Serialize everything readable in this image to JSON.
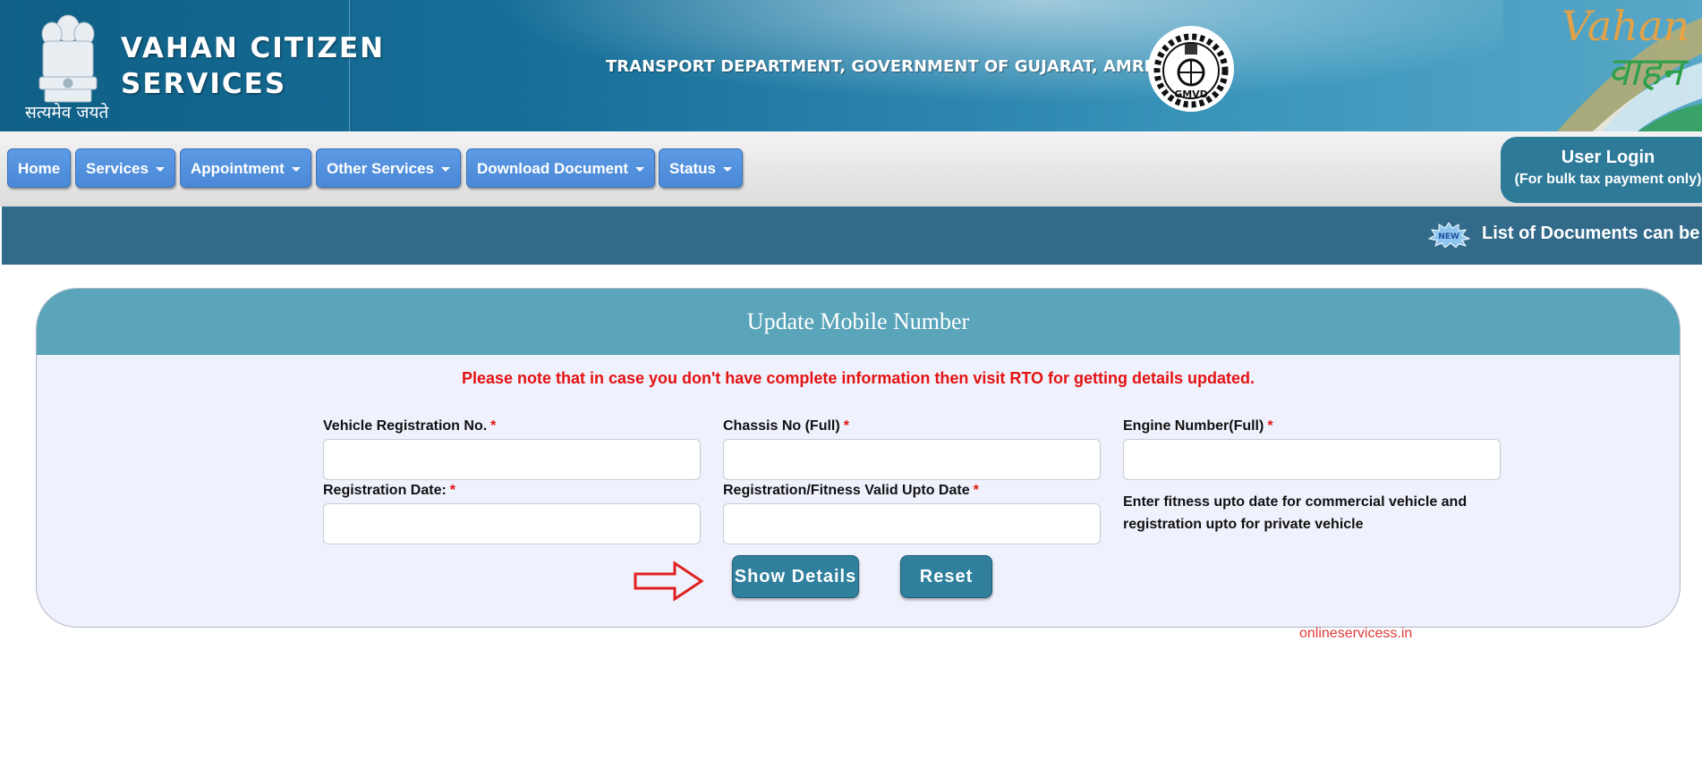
{
  "header": {
    "motto": "सत्यमेव जयते",
    "title_line1": "VAHAN CITIZEN",
    "title_line2": "SERVICES",
    "department": "TRANSPORT DEPARTMENT, GOVERNMENT OF GUJARAT, AMRELI",
    "gmvd_label": "GMVD",
    "vahan_logo_line1": "Vahan",
    "vahan_logo_line2": "वाहन"
  },
  "nav": {
    "items": [
      {
        "label": "Home",
        "has_dropdown": false
      },
      {
        "label": "Services",
        "has_dropdown": true
      },
      {
        "label": "Appointment",
        "has_dropdown": true
      },
      {
        "label": "Other Services",
        "has_dropdown": true
      },
      {
        "label": "Download Document",
        "has_dropdown": true
      },
      {
        "label": "Status",
        "has_dropdown": true
      }
    ],
    "user_login": {
      "title": "User Login",
      "subtitle": "(For bulk tax payment only)"
    }
  },
  "ticker": {
    "badge": "NEW",
    "text": "List of Documents can be v"
  },
  "form": {
    "title": "Update Mobile Number",
    "notice": "Please note that in case you don't have complete information then visit RTO for getting details updated.",
    "fields": {
      "vehicle_reg_no": {
        "label": "Vehicle Registration No.",
        "value": ""
      },
      "chassis_no": {
        "label": "Chassis No (Full)",
        "value": ""
      },
      "engine_no": {
        "label": "Engine Number(Full)",
        "value": ""
      },
      "registration_date": {
        "label": "Registration Date:",
        "value": ""
      },
      "fitness_valid_upto": {
        "label": "Registration/Fitness Valid Upto Date",
        "value": ""
      }
    },
    "required_marker": "*",
    "hint": "Enter fitness upto date for commercial vehicle and registration upto for private vehicle",
    "show_details_label": "Show Details",
    "reset_label": "Reset"
  },
  "watermark": "onlineservicess.in",
  "colors": {
    "header_blue": "#166e97",
    "nav_button": "#4a87d6",
    "ticker_bg": "#326a8a",
    "card_header": "#5aa5ba",
    "card_bg": "#eff1fc",
    "action_button": "#2f7f9d",
    "required_red": "#e41212",
    "arrow_red": "#e02020"
  },
  "icons": [
    "national-emblem-icon",
    "gmvd-logo-icon",
    "new-badge-icon",
    "red-arrow-icon",
    "caret-down-icon"
  ]
}
